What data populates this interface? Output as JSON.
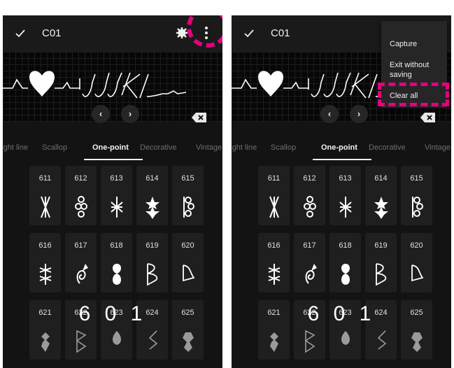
{
  "accent_color": "#e6007e",
  "screens": [
    {
      "header": {
        "title": "C01",
        "confirm_icon": "check-icon",
        "settings_icon": "gear-icon",
        "more_icon": "more-vert-icon"
      },
      "tabs": [
        "Straight line",
        "Scallop",
        "One-point",
        "Decorative",
        "Vintage"
      ],
      "active_tab": "One-point",
      "patterns": [
        "611",
        "612",
        "613",
        "614",
        "615",
        "616",
        "617",
        "618",
        "619",
        "620",
        "621",
        "622",
        "623",
        "624",
        "625"
      ],
      "overlay_number": "6 0 1"
    },
    {
      "header": {
        "title": "C01",
        "confirm_icon": "check-icon"
      },
      "menu": {
        "items": [
          "Capture",
          "Exit without saving",
          "Clear all"
        ]
      },
      "tabs": [
        "Straight line",
        "Scallop",
        "One-point",
        "Decorative",
        "Vintage"
      ],
      "active_tab": "One-point",
      "patterns": [
        "611",
        "612",
        "613",
        "614",
        "615",
        "616",
        "617",
        "618",
        "619",
        "620",
        "621",
        "622",
        "623",
        "624",
        "625"
      ],
      "overlay_number": "6 0 1"
    }
  ]
}
